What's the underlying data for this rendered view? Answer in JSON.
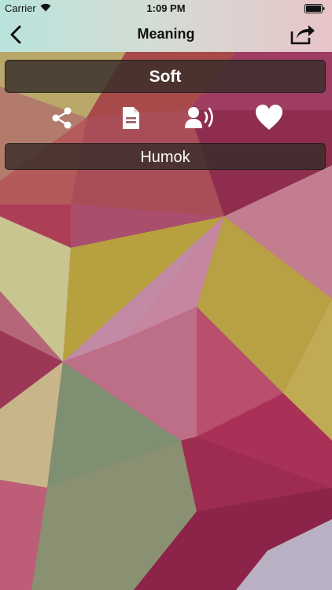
{
  "status_bar": {
    "carrier": "Carrier",
    "time": "1:09 PM",
    "wifi_icon": "wifi-icon",
    "battery_icon": "battery-icon"
  },
  "nav": {
    "title": "Meaning",
    "back_icon": "chevron-left-icon",
    "share_icon": "share-export-icon"
  },
  "word": "Soft",
  "meaning": "Humok",
  "actions": [
    {
      "icon": "share-icon",
      "name": "share-button"
    },
    {
      "icon": "document-icon",
      "name": "copy-button"
    },
    {
      "icon": "speak-icon",
      "name": "speak-button"
    },
    {
      "icon": "heart-icon",
      "name": "favorite-button"
    }
  ],
  "colors": {
    "nav_gradient_start": "#b9e3dc",
    "nav_gradient_end": "#e8c4c9",
    "bar_background": "#372d28",
    "text_light": "#ffffff"
  }
}
